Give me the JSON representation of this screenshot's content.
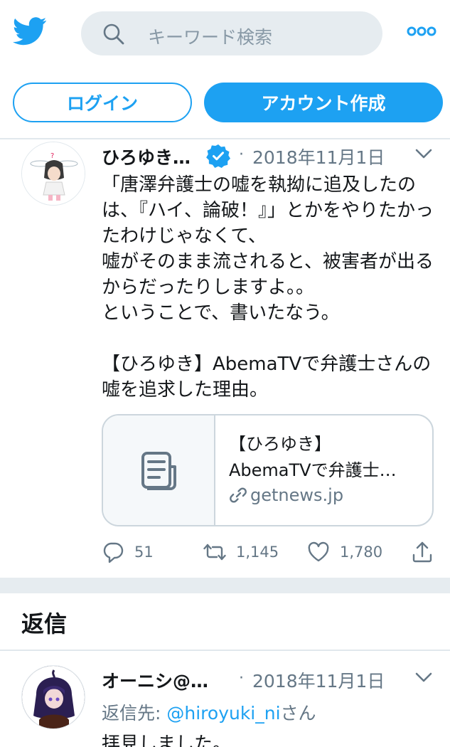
{
  "header": {
    "logo_icon": "twitter-bird-icon",
    "search_placeholder": "キーワード検索",
    "more_icon": "more-dots-icon",
    "brand_color": "#1da1f2"
  },
  "auth": {
    "login_label": "ログイン",
    "signup_label": "アカウント作成"
  },
  "tweet": {
    "author": "ひろゆき…",
    "verified_icon": "verified-badge-icon",
    "dot": "·",
    "date": "2018年11月1日",
    "text": "「唐澤弁護士の嘘を執拗に追及したのは、『ハイ、論破！』」とかをやりたかったわけじゃなくて、\n嘘がそのまま流されると、被害者が出るからだったりしますよ。。\nということで、書いたなう。\n\n【ひろゆき】AbemaTVで弁護士さんの嘘を追求した理由。",
    "card": {
      "thumb_icon": "document-icon",
      "title_line1": "【ひろゆき】",
      "title_line2": "AbemaTVで弁護士…",
      "domain": "getnews.jp",
      "link_icon": "link-icon"
    },
    "actions": {
      "reply_count": "51",
      "retweet_count": "1,145",
      "like_count": "1,780"
    }
  },
  "replies": {
    "heading": "返信",
    "items": [
      {
        "author": "オーニシ@…",
        "dot": "·",
        "date": "2018年11月1日",
        "reply_to_prefix": "返信先: ",
        "reply_to_handle": "@hiroyuki_ni",
        "reply_to_suffix": "さん",
        "text": "拝見しました。"
      }
    ]
  }
}
